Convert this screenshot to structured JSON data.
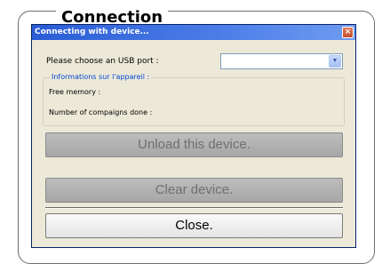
{
  "section": {
    "title": "Connection"
  },
  "window": {
    "title": "Connecting with device...",
    "close_glyph": "×",
    "port_label": "Please choose an USB port :",
    "port_value": "",
    "info": {
      "legend": "Informations sur l'appareil :",
      "free_memory": "Free memory :",
      "campaigns": "Number of compaigns done :"
    },
    "buttons": {
      "unload": "Unload this device.",
      "clear": "Clear device.",
      "close": "Close."
    }
  },
  "colors": {
    "titlebar": "#2a5cd6",
    "dialog_bg": "#ece9d8",
    "disabled_button": "#a6a6a6",
    "legend_text": "#0046d5"
  },
  "icons": {
    "dropdown": "chevron-down-icon",
    "close": "close-icon"
  }
}
